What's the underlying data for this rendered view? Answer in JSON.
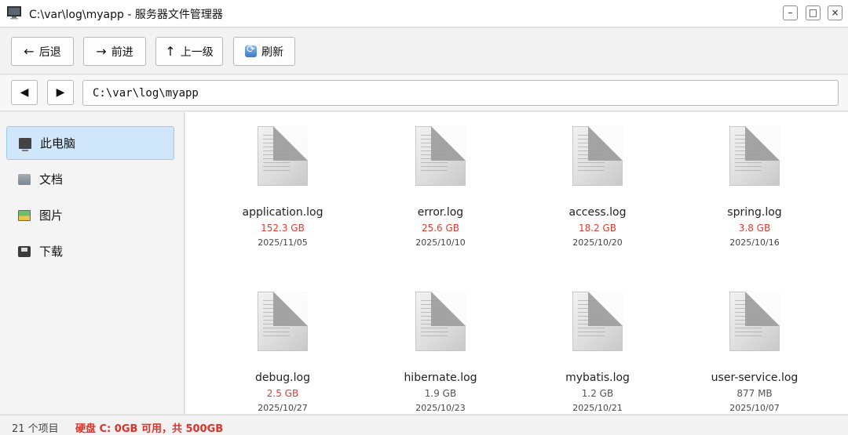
{
  "window": {
    "title": "C:\\var\\log\\myapp - 服务器文件管理器",
    "min_glyph": "–",
    "max_glyph": "□",
    "close_glyph": "×"
  },
  "toolbar": {
    "back": {
      "icon": "←",
      "label": "后退"
    },
    "forward": {
      "icon": "→",
      "label": "前进"
    },
    "up": {
      "icon": "↑",
      "label": "上一级"
    },
    "refresh": {
      "label": "刷新"
    }
  },
  "address": {
    "left_glyph": "◀",
    "right_glyph": "▶",
    "path": "C:\\var\\log\\myapp"
  },
  "sidebar": {
    "items": [
      {
        "label": "此电脑",
        "icon": "monitor-icon",
        "active": true
      },
      {
        "label": "文档",
        "icon": "folder-icon",
        "active": false
      },
      {
        "label": "图片",
        "icon": "picture-icon",
        "active": false
      },
      {
        "label": "下载",
        "icon": "disk-icon",
        "active": false
      }
    ]
  },
  "files": [
    {
      "name": "application.log",
      "size": "152.3 GB",
      "date": "2025/11/05",
      "size_highlight": true
    },
    {
      "name": "error.log",
      "size": "25.6 GB",
      "date": "2025/10/10",
      "size_highlight": true
    },
    {
      "name": "access.log",
      "size": "18.2 GB",
      "date": "2025/10/20",
      "size_highlight": true
    },
    {
      "name": "spring.log",
      "size": "3.8 GB",
      "date": "2025/10/16",
      "size_highlight": true
    },
    {
      "name": "debug.log",
      "size": "2.5 GB",
      "date": "2025/10/27",
      "size_highlight": true
    },
    {
      "name": "hibernate.log",
      "size": "1.9 GB",
      "date": "2025/10/23",
      "size_highlight": false
    },
    {
      "name": "mybatis.log",
      "size": "1.2 GB",
      "date": "2025/10/21",
      "size_highlight": false
    },
    {
      "name": "user-service.log",
      "size": "877 MB",
      "date": "2025/10/07",
      "size_highlight": false
    }
  ],
  "status": {
    "count": "21 个项目",
    "disk": "硬盘 C: 0GB 可用，共 500GB"
  },
  "colors": {
    "highlight_size": "#e23a30",
    "disk_warning": "#e0322a",
    "active_sidebar": "#cfe6fb"
  }
}
